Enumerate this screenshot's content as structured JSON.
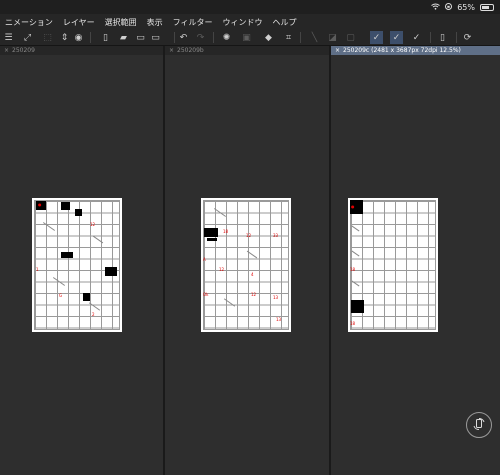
{
  "status": {
    "battery_text": "65%",
    "battery_level": 0.65
  },
  "menu": [
    "ニメーション",
    "レイヤー",
    "選択範囲",
    "表示",
    "フィルター",
    "ウィンドウ",
    "ヘルプ"
  ],
  "toolbar_icons": [
    "menu-icon",
    "expand-icon",
    "transform-icon",
    "layers-icon",
    "history-icon",
    "new-file-icon",
    "folder-icon",
    "save-icon",
    "export-icon",
    "loading-icon",
    "clear-icon",
    "fill-icon",
    "crop-icon",
    "undo-icon",
    "redo-icon",
    "brush-tool-icon",
    "pen-tool-icon",
    "vector-pen-icon",
    "smartphone-icon",
    "refresh-icon"
  ],
  "tabs": [
    {
      "label": "250209",
      "active": false
    },
    {
      "label": "250209b",
      "active": false
    },
    {
      "label": "250209c (2481 x 3687px 72dpi 12.5%)",
      "active": true
    }
  ],
  "colors": {
    "background": "#2b2b2b",
    "active_tab": "#5f6f87",
    "annotation_red": "#e00000"
  }
}
